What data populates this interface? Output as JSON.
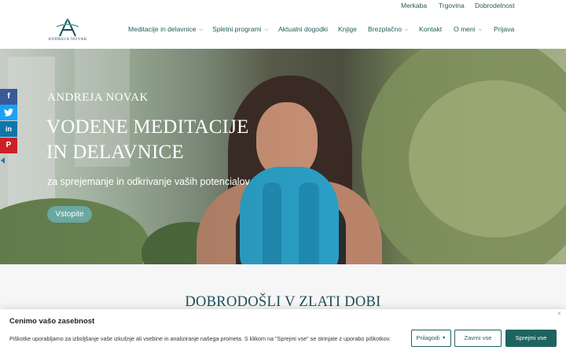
{
  "topbar": {
    "links": [
      "Merkaba",
      "Trgovina",
      "Dobrodelnost"
    ]
  },
  "header": {
    "logo_text": "ANDREJA NOVAK",
    "nav": [
      {
        "label": "Meditacije in delavnice",
        "has_dropdown": true
      },
      {
        "label": "Spletni programi",
        "has_dropdown": true
      },
      {
        "label": "Aktualni dogodki",
        "has_dropdown": false
      },
      {
        "label": "Knjige",
        "has_dropdown": false
      },
      {
        "label": "Brezplačno",
        "has_dropdown": true
      },
      {
        "label": "Kontakt",
        "has_dropdown": false
      },
      {
        "label": "O meni",
        "has_dropdown": true
      },
      {
        "label": "Prijava",
        "has_dropdown": false
      }
    ],
    "chevron_icon": "chevron-down-icon"
  },
  "hero": {
    "subtitle": "ANDREJA NOVAK",
    "title_line1": "VODENE MEDITACIJE",
    "title_line2": "IN DELAVNICE",
    "tagline": "za sprejemanje in odkrivanje vaših potencialov",
    "cta_label": "Vstopite"
  },
  "social": [
    {
      "icon": "facebook-icon",
      "glyph": "f",
      "color": "#3b5998"
    },
    {
      "icon": "twitter-icon",
      "glyph": "🐦",
      "color": "#1da1f2"
    },
    {
      "icon": "linkedin-icon",
      "glyph": "in",
      "color": "#0e76a8"
    },
    {
      "icon": "pinterest-icon",
      "glyph": "P",
      "color": "#cb2027"
    }
  ],
  "welcome": {
    "title": "DOBRODOŠLI V ZLATI DOBI"
  },
  "cookie": {
    "title": "Cenimo vašo zasebnost",
    "text": "Piškotke uporabljamo za izboljšanje vaše izkušnje ali vsebine in analiziranje našega prometa. S klikom na \"Sprejmi vse\" se strinjate z uporabo piškotkov.",
    "customize_label": "Prilagodi",
    "reject_label": "Zavrni vse",
    "accept_label": "Sprejmi vse",
    "close_glyph": "×"
  },
  "colors": {
    "brand": "#1f6360",
    "accent": "#6aa8a1",
    "nav_text": "#1f5d58"
  }
}
